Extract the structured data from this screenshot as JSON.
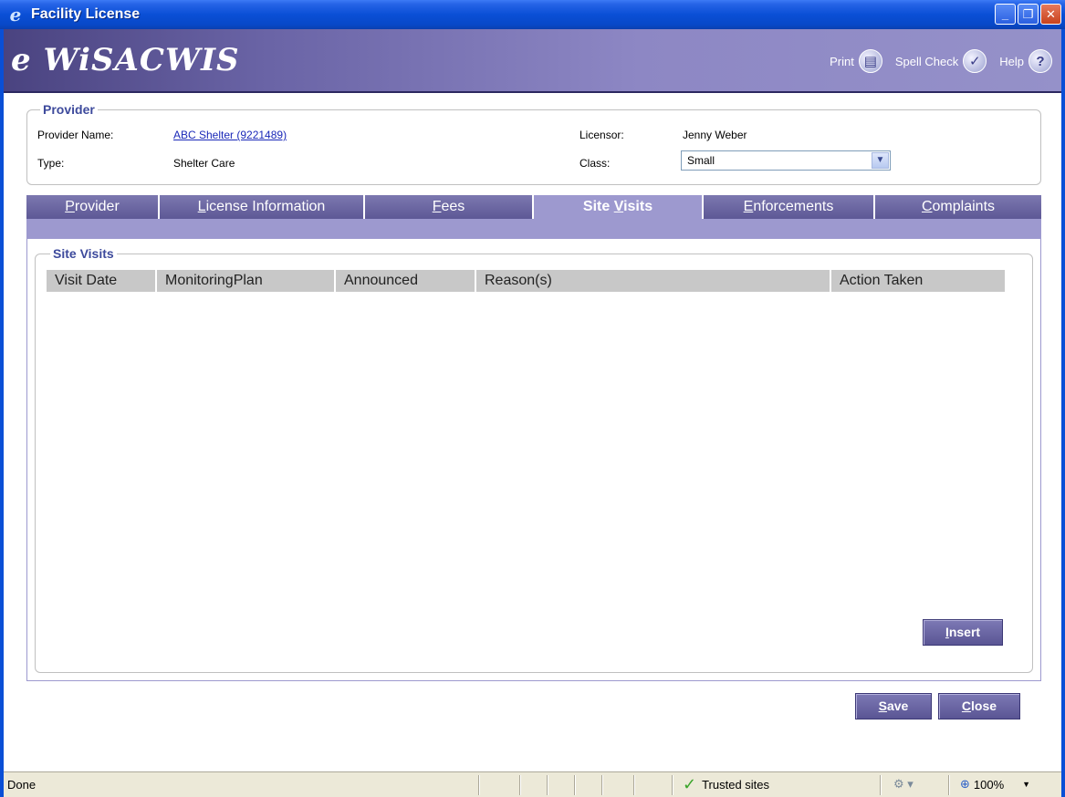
{
  "window": {
    "title": "Facility License",
    "buttons": [
      "_",
      "❐",
      "✕"
    ]
  },
  "brand": {
    "logo": "e WiSACWIS"
  },
  "toolbar": {
    "print": "Print",
    "spell": "Spell Check",
    "help": "Help"
  },
  "provider": {
    "legend": "Provider",
    "name_label": "Provider Name:",
    "name_value": "ABC Shelter (9221489)",
    "type_label": "Type:",
    "type_value": "Shelter Care",
    "licensor_label": "Licensor:",
    "licensor_value": "Jenny Weber",
    "class_label": "Class:",
    "class_value": "Small"
  },
  "tabs": [
    {
      "pre": "",
      "u": "P",
      "post": "rovider"
    },
    {
      "pre": "",
      "u": "L",
      "post": "icense Information"
    },
    {
      "pre": "",
      "u": "F",
      "post": "ees"
    },
    {
      "pre": "Site ",
      "u": "V",
      "post": "isits"
    },
    {
      "pre": "",
      "u": "E",
      "post": "nforcements"
    },
    {
      "pre": "",
      "u": "C",
      "post": "omplaints"
    }
  ],
  "site_visits": {
    "legend": "Site Visits",
    "columns": [
      "Visit Date",
      "MonitoringPlan",
      "Announced",
      "Reason(s)",
      "Action Taken"
    ]
  },
  "buttons": {
    "insert": {
      "u": "I",
      "post": "nsert"
    },
    "save": {
      "u": "S",
      "post": "ave"
    },
    "close": {
      "u": "C",
      "post": "lose"
    }
  },
  "status": {
    "text": "Done",
    "zone": "Trusted sites",
    "zoom": "100%"
  }
}
